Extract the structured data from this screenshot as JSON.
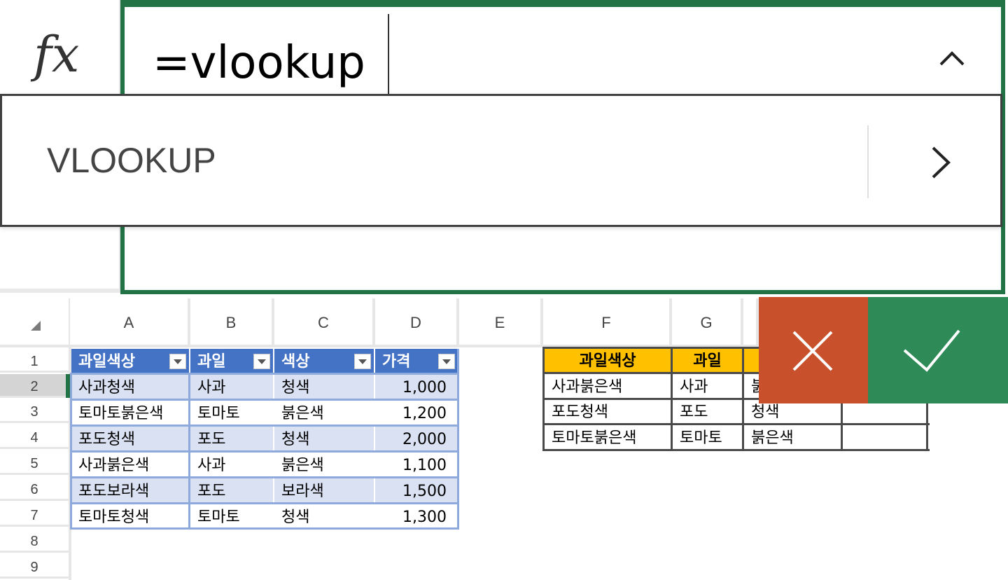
{
  "formula_bar": {
    "fx_label": "fx",
    "formula_text": "=vlookup",
    "collapse_icon": "chevron-up-icon"
  },
  "autocomplete": {
    "suggestion": "VLOOKUP",
    "expand_icon": "chevron-right-icon"
  },
  "columns": [
    "A",
    "B",
    "C",
    "D",
    "E",
    "F",
    "G"
  ],
  "rows": [
    "1",
    "2",
    "3",
    "4",
    "5",
    "6",
    "7",
    "8",
    "9"
  ],
  "table1": {
    "headers": [
      "과일색상",
      "과일",
      "색상",
      "가격"
    ],
    "rows": [
      [
        "사과청색",
        "사과",
        "청색",
        "1,000"
      ],
      [
        "토마토붉은색",
        "토마토",
        "붉은색",
        "1,200"
      ],
      [
        "포도청색",
        "포도",
        "청색",
        "2,000"
      ],
      [
        "사과붉은색",
        "사과",
        "붉은색",
        "1,100"
      ],
      [
        "포도보라색",
        "포도",
        "보라색",
        "1,500"
      ],
      [
        "토마토청색",
        "토마토",
        "청색",
        "1,300"
      ]
    ]
  },
  "table2": {
    "headers": [
      "과일색상",
      "과일"
    ],
    "rows": [
      [
        "사과붉은색",
        "사과",
        "붉"
      ],
      [
        "포도청색",
        "포도",
        "청색"
      ],
      [
        "토마토붉은색",
        "토마토",
        "붉은색"
      ]
    ]
  },
  "actions": {
    "cancel_icon": "close-icon",
    "enter_icon": "checkmark-icon"
  },
  "colors": {
    "accent": "#217346",
    "table_header": "#4472c4",
    "table_band": "#d9e1f2",
    "lookup_header": "#ffc000",
    "cancel": "#c8502a",
    "enter": "#2e8b57"
  }
}
